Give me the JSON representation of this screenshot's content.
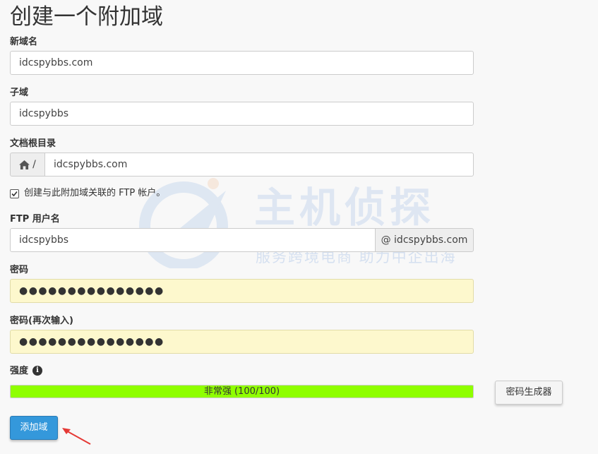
{
  "page": {
    "title": "创建一个附加域"
  },
  "new_domain": {
    "label": "新域名",
    "value": "idcspybbs.com"
  },
  "subdomain": {
    "label": "子域",
    "value": "idcspybbs"
  },
  "docroot": {
    "label": "文档根目录",
    "prefix": "/",
    "value": "idcspybbs.com"
  },
  "ftp_checkbox": {
    "label": "创建与此附加域关联的 FTP 帐户。",
    "checked": true
  },
  "ftp_username": {
    "label": "FTP 用户名",
    "value": "idcspybbs",
    "suffix": "@ idcspybbs.com"
  },
  "password": {
    "label": "密码",
    "value": "●●●●●●●●●●●●●●●"
  },
  "password_confirm": {
    "label": "密码(再次输入)",
    "value": "●●●●●●●●●●●●●●●"
  },
  "strength": {
    "label": "强度",
    "text": "非常强 (100/100)",
    "score": 100,
    "color": "#8fff00"
  },
  "buttons": {
    "generator": "密码生成器",
    "add": "添加域"
  },
  "watermark": {
    "main": "主机侦探",
    "sub": "服务跨境电商 助力中企出海"
  },
  "colors": {
    "primary": "#3498db",
    "password_bg": "#fdf8cd"
  }
}
